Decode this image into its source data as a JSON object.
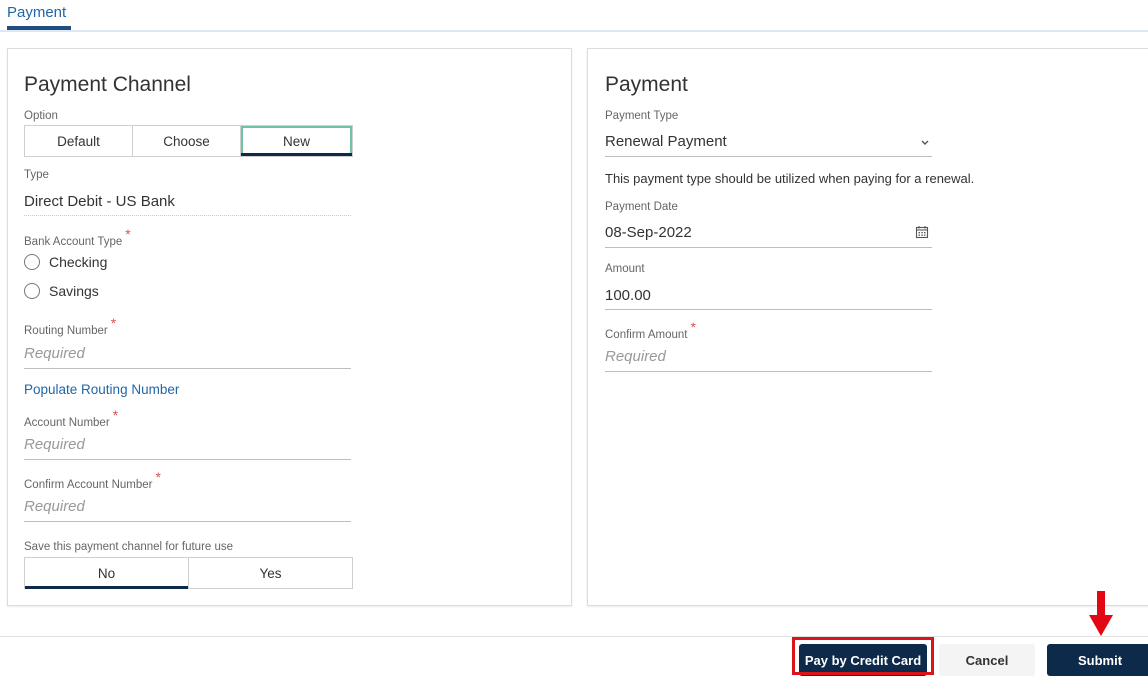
{
  "tab": {
    "label": "Payment"
  },
  "channel": {
    "title": "Payment Channel",
    "option_label": "Option",
    "options": [
      "Default",
      "Choose",
      "New"
    ],
    "selected_option": "New",
    "type_label": "Type",
    "type_value": "Direct Debit - US Bank",
    "bank_account_type_label": "Bank Account Type",
    "bank_account_types": [
      "Checking",
      "Savings"
    ],
    "routing_label": "Routing Number",
    "routing_placeholder": "Required",
    "populate_link": "Populate Routing Number",
    "account_label": "Account Number",
    "account_placeholder": "Required",
    "confirm_account_label": "Confirm Account Number",
    "confirm_account_placeholder": "Required",
    "save_label": "Save this payment channel for future use",
    "save_options": [
      "No",
      "Yes"
    ],
    "save_selected": "No",
    "required_marker": "*"
  },
  "payment": {
    "title": "Payment",
    "type_label": "Payment Type",
    "type_value": "Renewal Payment",
    "type_hint": "This payment type should be utilized when paying for a renewal.",
    "date_label": "Payment Date",
    "date_value": "08-Sep-2022",
    "amount_label": "Amount",
    "amount_value": "100.00",
    "confirm_amount_label": "Confirm Amount",
    "confirm_amount_placeholder": "Required"
  },
  "footer": {
    "credit_card_label": "Pay by Credit Card",
    "cancel_label": "Cancel",
    "submit_label": "Submit"
  },
  "colors": {
    "primary_dark": "#0d2a4a",
    "link_blue": "#2266a8",
    "required_red": "#d9534f",
    "highlight_red": "#d9141b",
    "active_green": "#6fc3a3"
  }
}
